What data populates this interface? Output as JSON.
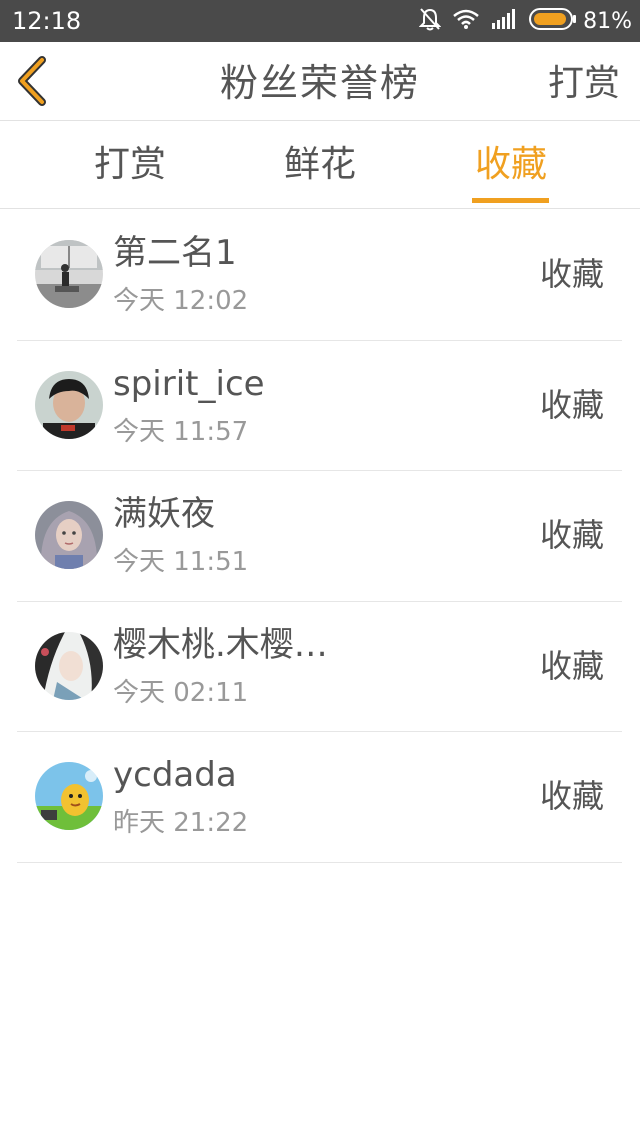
{
  "status_bar": {
    "time": "12:18",
    "battery": "81%",
    "icons": [
      "bell-off-icon",
      "wifi-icon",
      "signal-icon",
      "battery-icon"
    ],
    "battery_color": "#f0a020"
  },
  "header": {
    "title": "粉丝荣誉榜",
    "right_action": "打赏",
    "back_icon": "chevron-left-icon",
    "back_color": "#f0a020"
  },
  "tabs": [
    {
      "label": "打赏"
    },
    {
      "label": "鲜花"
    },
    {
      "label": "收藏",
      "active": true
    }
  ],
  "colors": {
    "accent": "#f0a020",
    "text": "#555555",
    "subtext": "#999999"
  },
  "list": [
    {
      "name": "第二名1",
      "time": "今天 12:02",
      "type": "收藏"
    },
    {
      "name": "spirit_ice",
      "time": "今天 11:57",
      "type": "收藏"
    },
    {
      "name": "满妖夜",
      "time": "今天 11:51",
      "type": "收藏"
    },
    {
      "name": "樱木桃.木樱…",
      "time": "今天 02:11",
      "type": "收藏"
    },
    {
      "name": "ycdada",
      "time": "昨天 21:22",
      "type": "收藏"
    }
  ]
}
